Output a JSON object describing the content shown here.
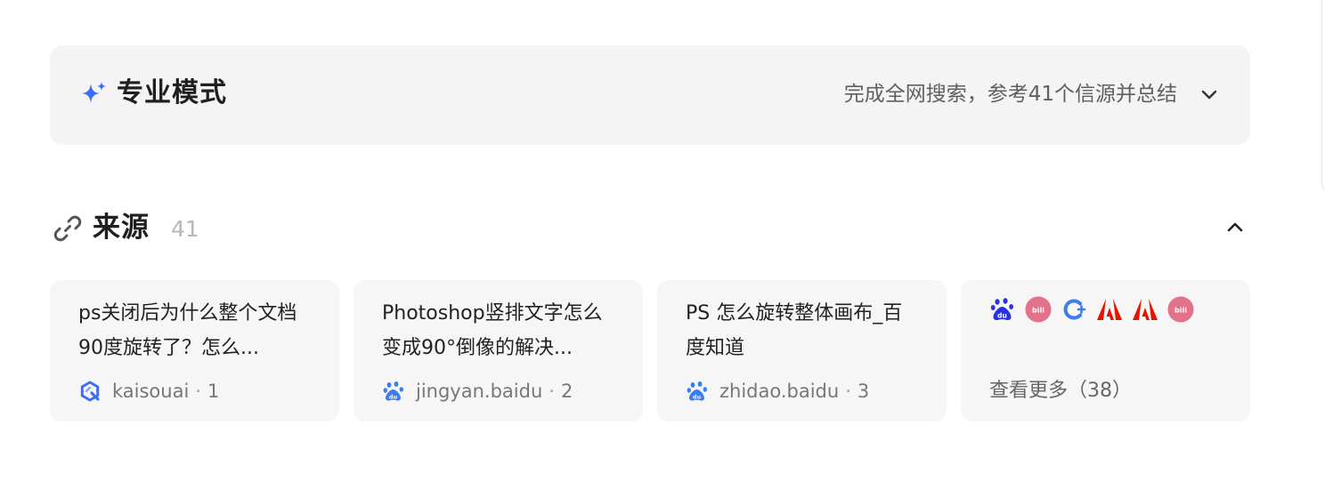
{
  "mode": {
    "title": "专业模式",
    "summary": "完成全网搜索，参考41个信源并总结",
    "icon": "sparkle-icon",
    "accent": "#3b6cf6"
  },
  "sources": {
    "title": "来源",
    "count": "41",
    "icon": "link-icon"
  },
  "cards": [
    {
      "title": "ps关闭后为什么整个文档90度旋转了？怎么...",
      "source": "kaisouai",
      "index": "1",
      "icon": "kaisouai-icon"
    },
    {
      "title": "Photoshop竖排文字怎么变成90°倒像的解决...",
      "source": "jingyan.baidu",
      "index": "2",
      "icon": "baidu-icon"
    },
    {
      "title": "PS 怎么旋转整体画布_百度知道",
      "source": "zhidao.baidu",
      "index": "3",
      "icon": "baidu-icon"
    }
  ],
  "more": {
    "label": "查看更多（38）",
    "icons": [
      "baidu-icon",
      "bilibili-icon",
      "cplus-icon",
      "adobe-icon",
      "adobe-icon",
      "bilibili-icon"
    ]
  },
  "colors": {
    "panel_bg": "#f4f4f4",
    "card_bg": "#f6f6f6",
    "baidu_blue": "#2d5be3",
    "adobe_red": "#eb1000",
    "bilibili_pink": "#e1728a"
  }
}
